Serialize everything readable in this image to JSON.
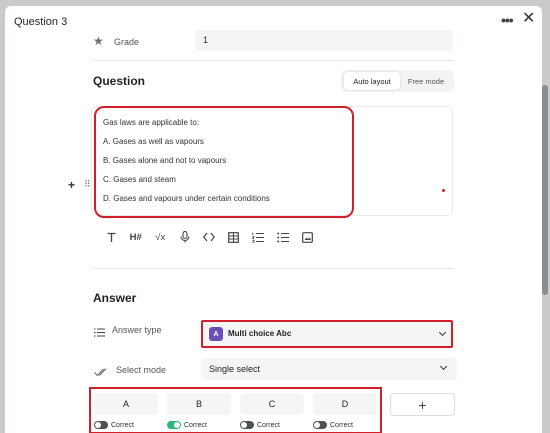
{
  "header": {
    "title": "Question 3",
    "more_label": "•••",
    "close_label": "✕"
  },
  "grade": {
    "label": "Grade",
    "value": "1",
    "icon": "star-icon"
  },
  "question": {
    "title": "Question",
    "layout_modes": [
      "Auto layout",
      "Free mode"
    ],
    "selected_mode": "Auto layout",
    "lines": [
      "Gas laws are applicable to:",
      "A. Gases as well as vapours",
      "B. Gases alone and not to vapours",
      "C. Gases and steam",
      "D. Gases and vapours under certain conditions"
    ]
  },
  "toolbar": {
    "items": [
      {
        "name": "text-icon",
        "glyph": "T"
      },
      {
        "name": "heading-icon",
        "glyph": "H#"
      },
      {
        "name": "formula-icon",
        "glyph": "√x"
      },
      {
        "name": "microphone-icon",
        "glyph": "mic"
      },
      {
        "name": "code-icon",
        "glyph": "<>"
      },
      {
        "name": "table-icon",
        "glyph": "table"
      },
      {
        "name": "numbered-list-icon",
        "glyph": "ol"
      },
      {
        "name": "bullet-list-icon",
        "glyph": "ul"
      },
      {
        "name": "image-icon",
        "glyph": "img"
      }
    ]
  },
  "answer": {
    "title": "Answer",
    "answer_type": {
      "label": "Answer type",
      "badge": "A",
      "value": "Multi choice Abc"
    },
    "select_mode": {
      "label": "Select mode",
      "value": "Single select"
    },
    "options": [
      {
        "label": "A",
        "correct_label": "Correct",
        "correct": false
      },
      {
        "label": "B",
        "correct_label": "Correct",
        "correct": true
      },
      {
        "label": "C",
        "correct_label": "Correct",
        "correct": false
      },
      {
        "label": "D",
        "correct_label": "Correct",
        "correct": false
      }
    ],
    "add_label": "+"
  },
  "colors": {
    "highlight": "#d0212a",
    "toggle_on": "#2db87a",
    "badge": "#6a4fb5"
  }
}
